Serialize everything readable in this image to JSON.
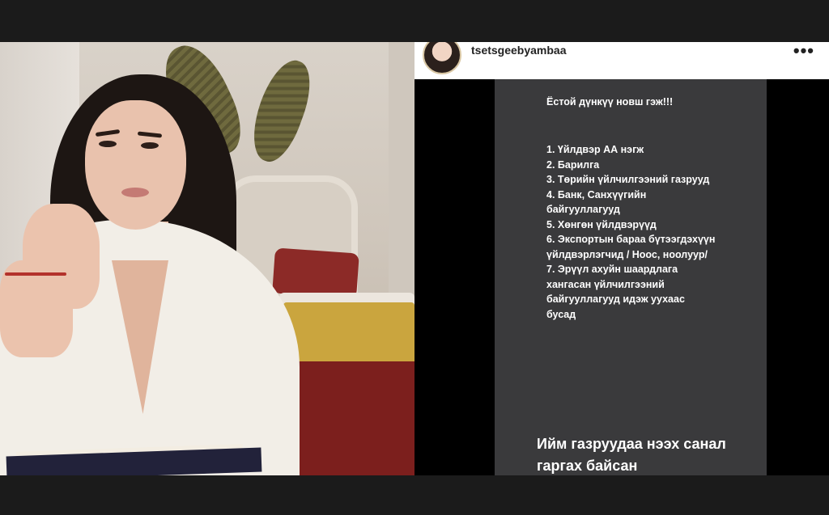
{
  "post": {
    "username": "tsetsgeebyambaa",
    "more_icon": "•••"
  },
  "story": {
    "intro": "Ёстой дүнкүү новш гэж!!!",
    "items": [
      "1. Үйлдвэр АА нэгж",
      "2. Барилга",
      "3. Төрийн үйлчилгээний газрууд",
      "4. Банк, Санхүүгийн байгууллагууд",
      "5. Хөнгөн үйлдвэрүүд",
      "6. Экспортын бараа бүтээгдэхүүн үйлдвэрлэгчид / Ноос, ноолуур/",
      "7. Эрүүл ахуйн шаардлага хангасан үйлчилгээний байгууллагууд идэж уухаас бусад"
    ],
    "footer": "Ийм газруудаа нээх санал гаргах байсан"
  },
  "colors": {
    "background": "#1a1a1a",
    "story_card": "#3a3a3c",
    "story_bg": "#000000",
    "header_bg": "#ffffff"
  }
}
